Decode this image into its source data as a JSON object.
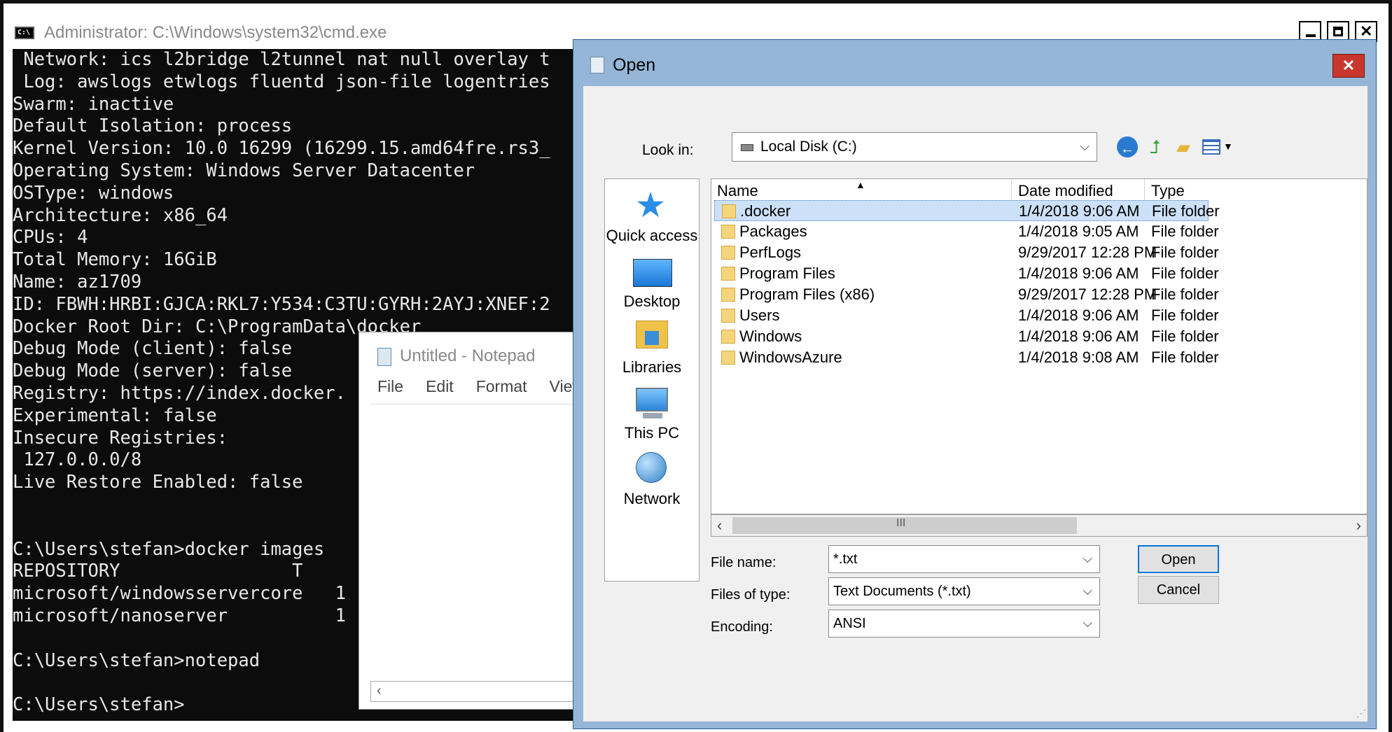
{
  "cmd": {
    "title": "Administrator: C:\\Windows\\system32\\cmd.exe",
    "lines": [
      " Network: ics l2bridge l2tunnel nat null overlay t",
      " Log: awslogs etwlogs fluentd json-file logentries",
      "Swarm: inactive",
      "Default Isolation: process",
      "Kernel Version: 10.0 16299 (16299.15.amd64fre.rs3_",
      "Operating System: Windows Server Datacenter",
      "OSType: windows",
      "Architecture: x86_64",
      "CPUs: 4",
      "Total Memory: 16GiB",
      "Name: az1709",
      "ID: FBWH:HRBI:GJCA:RKL7:Y534:C3TU:GYRH:2AYJ:XNEF:2",
      "Docker Root Dir: C:\\ProgramData\\docker",
      "Debug Mode (client): false",
      "Debug Mode (server): false",
      "Registry: https://index.docker.",
      "Experimental: false",
      "Insecure Registries:",
      " 127.0.0.0/8",
      "Live Restore Enabled: false",
      "",
      "",
      "C:\\Users\\stefan>docker images",
      "REPOSITORY                T",
      "microsoft/windowsservercore   1",
      "microsoft/nanoserver          1",
      "",
      "C:\\Users\\stefan>notepad",
      "",
      "C:\\Users\\stefan>"
    ]
  },
  "notepad": {
    "title": "Untitled - Notepad",
    "menu": [
      "File",
      "Edit",
      "Format",
      "View"
    ]
  },
  "dialog": {
    "title": "Open",
    "close_glyph": "✕",
    "look_in_label": "Look in:",
    "look_in_value": "Local Disk (C:)",
    "places": [
      "Quick access",
      "Desktop",
      "Libraries",
      "This PC",
      "Network"
    ],
    "columns": [
      "Name",
      "Date modified",
      "Type"
    ],
    "files": [
      {
        "name": ".docker",
        "date": "1/4/2018 9:06 AM",
        "type": "File folder",
        "selected": true
      },
      {
        "name": "Packages",
        "date": "1/4/2018 9:05 AM",
        "type": "File folder"
      },
      {
        "name": "PerfLogs",
        "date": "9/29/2017 12:28 PM",
        "type": "File folder"
      },
      {
        "name": "Program Files",
        "date": "1/4/2018 9:06 AM",
        "type": "File folder"
      },
      {
        "name": "Program Files (x86)",
        "date": "9/29/2017 12:28 PM",
        "type": "File folder"
      },
      {
        "name": "Users",
        "date": "1/4/2018 9:06 AM",
        "type": "File folder"
      },
      {
        "name": "Windows",
        "date": "1/4/2018 9:06 AM",
        "type": "File folder"
      },
      {
        "name": "WindowsAzure",
        "date": "1/4/2018 9:08 AM",
        "type": "File folder"
      }
    ],
    "file_name_label": "File name:",
    "file_name_value": "*.txt",
    "file_type_label": "Files of type:",
    "file_type_value": "Text Documents (*.txt)",
    "encoding_label": "Encoding:",
    "encoding_value": "ANSI",
    "open_label": "Open",
    "cancel_label": "Cancel",
    "scroll_grip": "III"
  }
}
